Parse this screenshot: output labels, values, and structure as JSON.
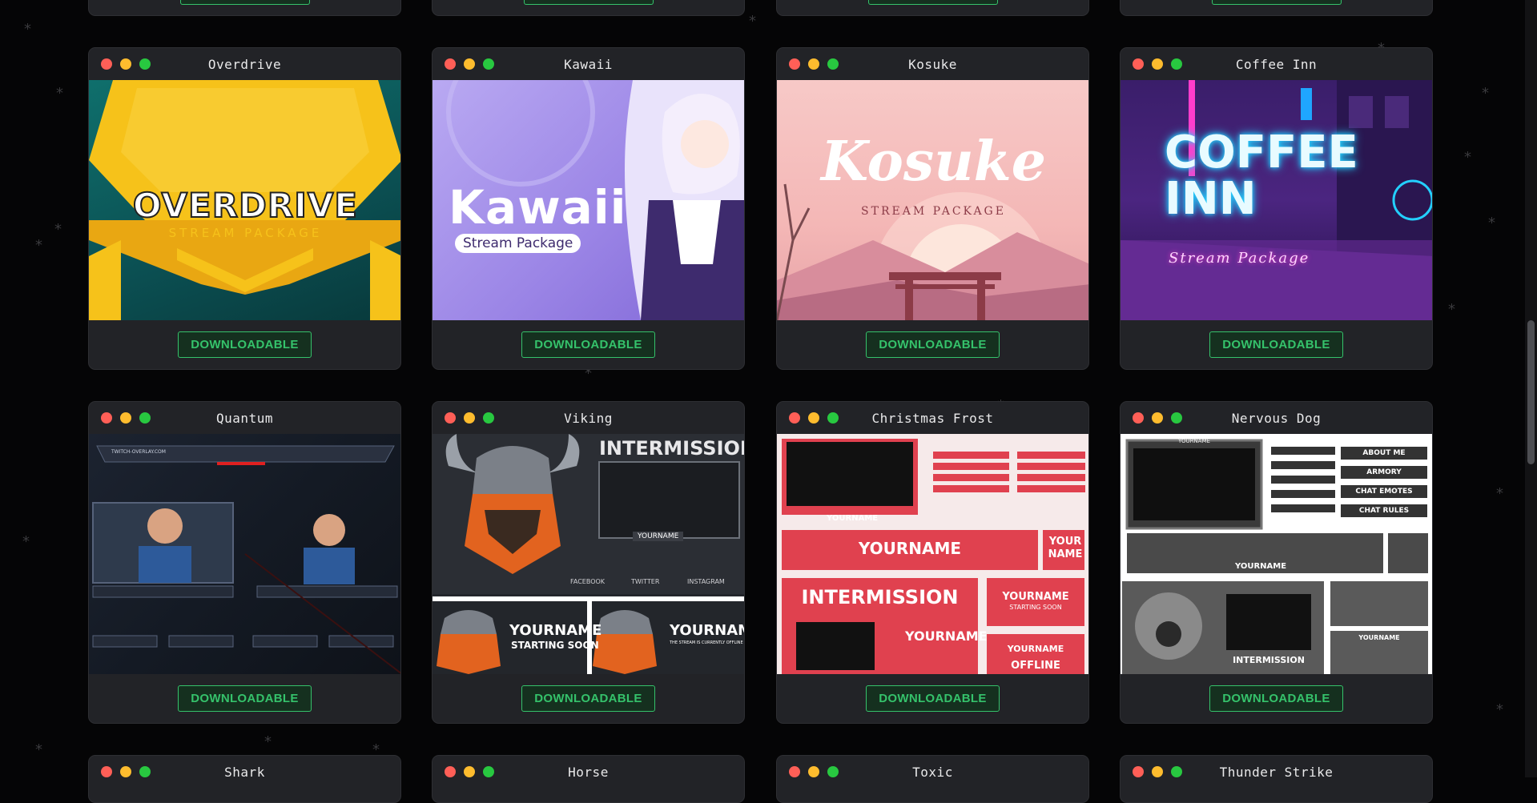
{
  "button_label": "DOWNLOADABLE",
  "cards": [
    {
      "title": "Overdrive",
      "thumb": {
        "line1": "OVERDRIVE",
        "line2": "STREAM PACKAGE"
      }
    },
    {
      "title": "Kawaii",
      "thumb": {
        "line1": "Kawaii",
        "line2": "Stream Package"
      }
    },
    {
      "title": "Kosuke",
      "thumb": {
        "line1": "Kosuke",
        "line2": "STREAM PACKAGE"
      }
    },
    {
      "title": "Coffee Inn",
      "thumb": {
        "line1": "COFFEE",
        "line2": "INN",
        "line3": "Stream Package"
      }
    },
    {
      "title": "Quantum",
      "thumb": {
        "line1": "TWITCH-OVERLAY.COM"
      }
    },
    {
      "title": "Viking",
      "thumb": {
        "line1": "INTERMISSION",
        "line2": "YOURNAME",
        "line3": "FACEBOOK",
        "line4": "TWITTER",
        "line5": "INSTAGRAM",
        "line6": "STARTING SOON",
        "line7": "THE STREAM IS CURRENTLY OFFLINE"
      }
    },
    {
      "title": "Christmas Frost",
      "thumb": {
        "line1": "YOURNAME",
        "line2": "INTERMISSION",
        "line3": "YOUR NAME",
        "line4": "STARTING SOON",
        "line5": "OFFLINE"
      }
    },
    {
      "title": "Nervous Dog",
      "thumb": {
        "line1": "YOURNAME",
        "line2": "ABOUT ME",
        "line3": "ARMORY",
        "line4": "CHAT EMOTES",
        "line5": "CHAT RULES",
        "line6": "INTERMISSION"
      }
    },
    {
      "title": "Shark"
    },
    {
      "title": "Horse"
    },
    {
      "title": "Toxic"
    },
    {
      "title": "Thunder Strike"
    }
  ],
  "colors": {
    "page_bg": "#050506",
    "card_bg": "#222327",
    "accent_green": "#35c26b",
    "dot_red": "#ff5f57",
    "dot_yellow": "#febc2e",
    "dot_green": "#28c840"
  }
}
